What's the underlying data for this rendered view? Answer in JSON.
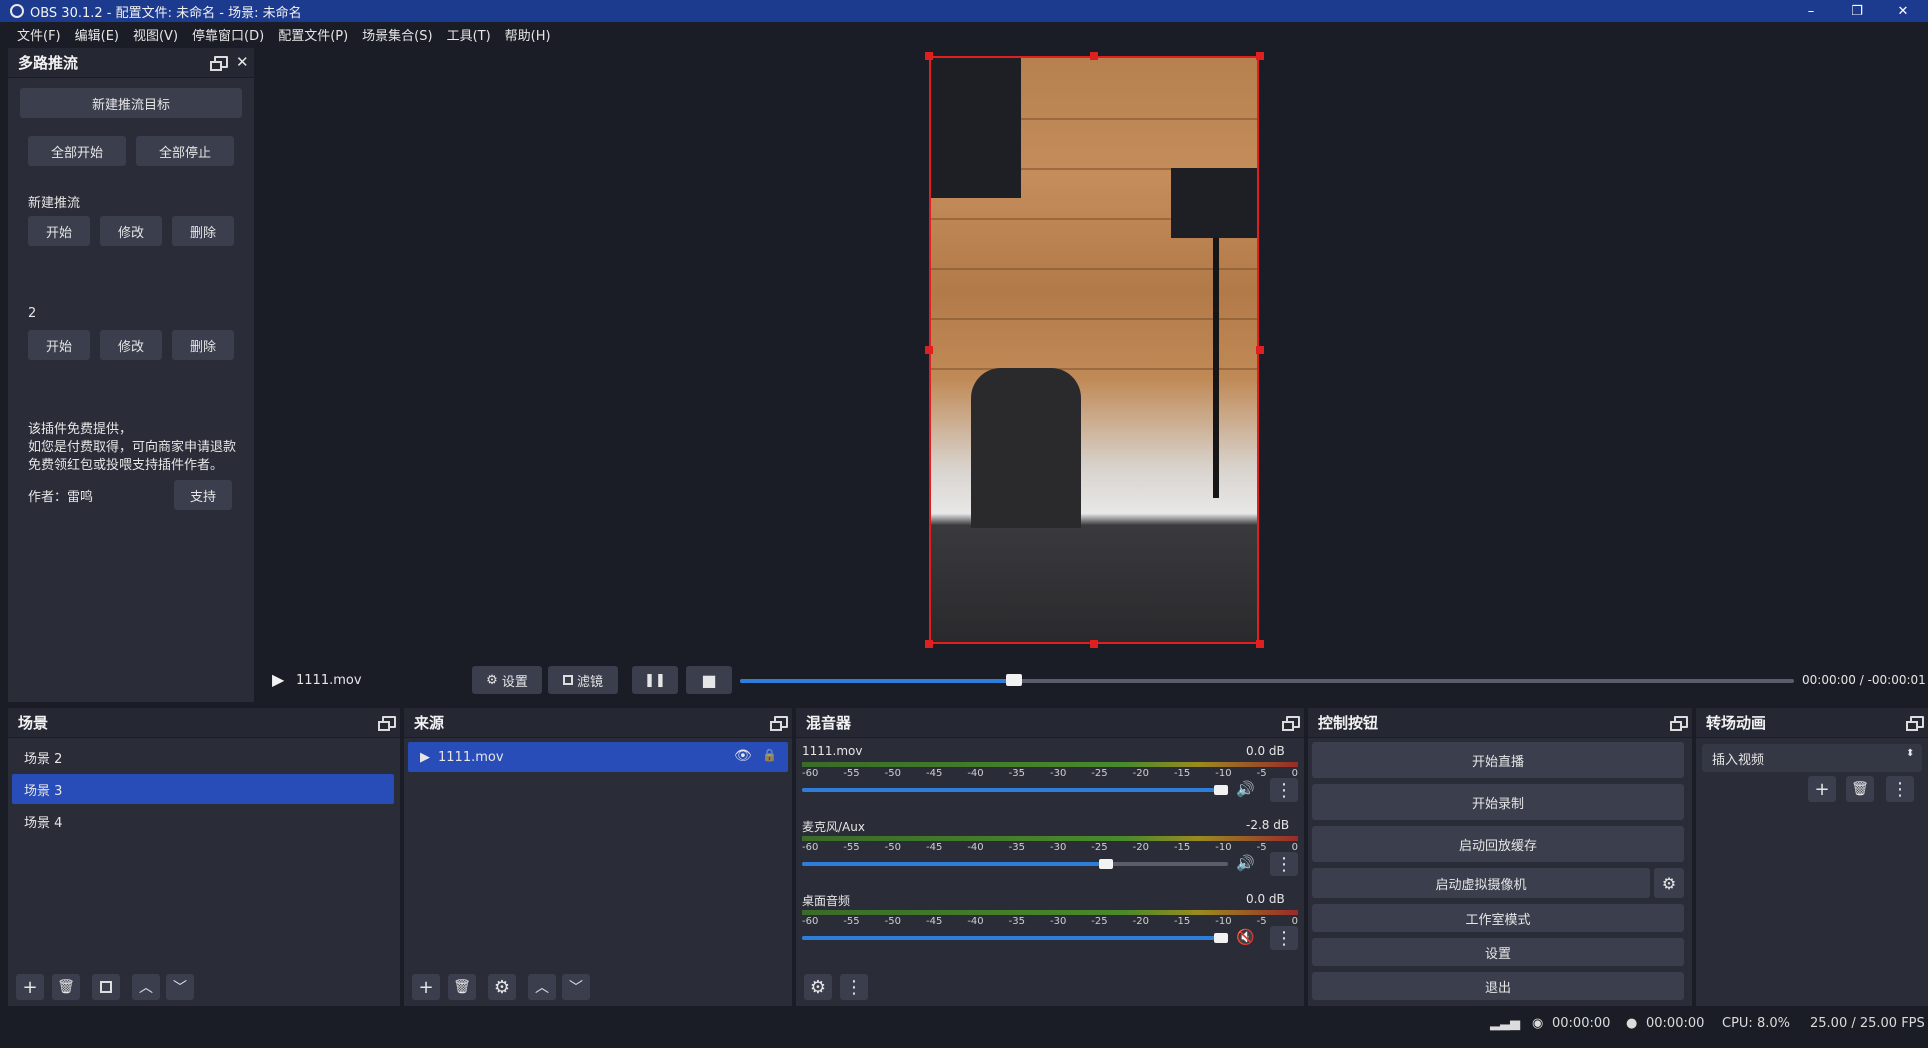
{
  "window": {
    "title": "OBS 30.1.2 - 配置文件: 未命名 - 场景: 未命名",
    "controls": [
      "–",
      "❐",
      "✕"
    ]
  },
  "menu": [
    "文件(F)",
    "编辑(E)",
    "视图(V)",
    "停靠窗口(D)",
    "配置文件(P)",
    "场景集合(S)",
    "工具(T)",
    "帮助(H)"
  ],
  "multistream": {
    "title": "多路推流",
    "new_target": "新建推流目标",
    "start_all": "全部开始",
    "stop_all": "全部停止",
    "streams": [
      {
        "name": "新建推流",
        "start": "开始",
        "edit": "修改",
        "delete": "删除"
      },
      {
        "name": "2",
        "start": "开始",
        "edit": "修改",
        "delete": "删除"
      }
    ],
    "notice_lines": [
      "该插件免费提供，",
      "如您是付费取得，可向商家申请退款",
      "免费领红包或投喂支持插件作者。"
    ],
    "author": "作者：雷鸣",
    "support": "支持"
  },
  "media": {
    "source_name": "1111.mov",
    "settings": "设置",
    "filters": "滤镜",
    "time": "00:00:00  /  -00:00:01",
    "progress": 0.26
  },
  "scenes": {
    "title": "场景",
    "items": [
      "场景 2",
      "场景 3",
      "场景 4"
    ],
    "selected": 1
  },
  "sources": {
    "title": "来源",
    "items": [
      "1111.mov"
    ]
  },
  "mixer": {
    "title": "混音器",
    "ticks": [
      "-60",
      "-55",
      "-50",
      "-45",
      "-40",
      "-35",
      "-30",
      "-25",
      "-20",
      "-15",
      "-10",
      "-5",
      "0"
    ],
    "channels": [
      {
        "name": "1111.mov",
        "db": "0.0 dB",
        "volume": 1.0,
        "muted": false
      },
      {
        "name": "麦克风/Aux",
        "db": "-2.8 dB",
        "volume": 0.73,
        "muted": false
      },
      {
        "name": "桌面音频",
        "db": "0.0 dB",
        "volume": 1.0,
        "muted": true
      }
    ]
  },
  "controls": {
    "title": "控制按钮",
    "start_stream": "开始直播",
    "start_record": "开始录制",
    "replay_buffer": "启动回放缓存",
    "virtual_cam": "启动虚拟摄像机",
    "studio_mode": "工作室模式",
    "settings": "设置",
    "exit": "退出"
  },
  "transitions": {
    "title": "转场动画",
    "selected": "插入视频"
  },
  "status": {
    "stream_time": "00:00:00",
    "record_time": "00:00:00",
    "cpu": "CPU: 8.0%",
    "fps": "25.00 / 25.00 FPS"
  },
  "icons": {
    "play": "▶",
    "pause": "❚❚",
    "stop": "■",
    "gear": "⚙",
    "plus": "+",
    "trash": "🗑",
    "up": "︿",
    "down": "﹀",
    "more": "⋮",
    "eye": "👁",
    "lock": "🔒",
    "speaker": "🔊",
    "mute": "🔇"
  }
}
